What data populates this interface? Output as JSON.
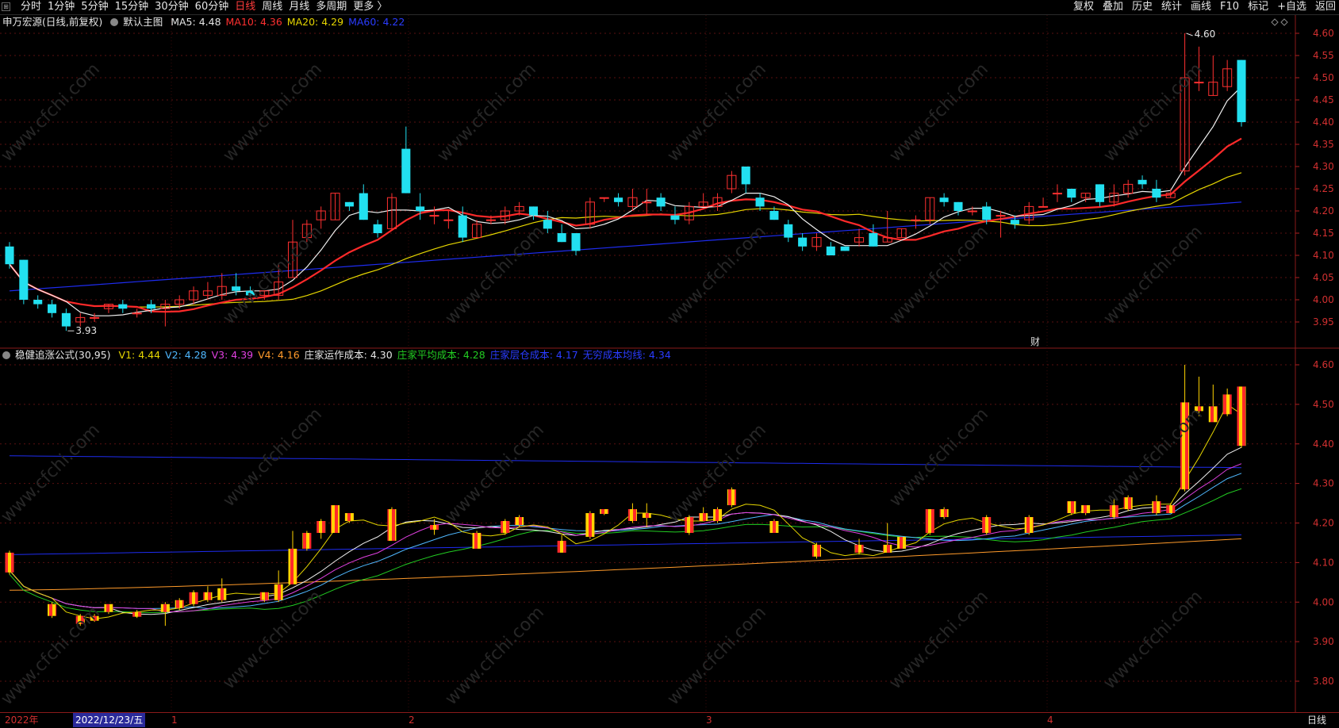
{
  "toolbar": {
    "left": [
      "分时",
      "1分钟",
      "5分钟",
      "15分钟",
      "30分钟",
      "60分钟",
      "日线",
      "周线",
      "月线",
      "多周期",
      "更多 〉"
    ],
    "active": "日线",
    "right": [
      "复权",
      "叠加",
      "历史",
      "统计",
      "画线",
      "F10",
      "标记",
      "+自选",
      "返回"
    ]
  },
  "main_header": {
    "stock": "申万宏源(日线,前复权)",
    "template": "默认主图",
    "ma": [
      {
        "label": "MA5: 4.48",
        "color": "#e6e6e6"
      },
      {
        "label": "MA10: 4.36",
        "color": "#ff3030"
      },
      {
        "label": "MA20: 4.29",
        "color": "#e6d600"
      },
      {
        "label": "MA60: 4.22",
        "color": "#2a3cff"
      }
    ]
  },
  "sub_header": {
    "name": "稳健追涨公式(30,95)",
    "items": [
      {
        "label": "V1: 4.44",
        "color": "#e6d600"
      },
      {
        "label": "V2: 4.28",
        "color": "#4fb8ff"
      },
      {
        "label": "V3: 4.39",
        "color": "#e040e0"
      },
      {
        "label": "V4: 4.16",
        "color": "#ff9a2a"
      },
      {
        "label": "庄家运作成本: 4.30",
        "color": "#e6e6e6"
      },
      {
        "label": "庄家平均成本: 4.28",
        "color": "#22cc22"
      },
      {
        "label": "庄家层仓成本: 4.17",
        "color": "#2a3cff"
      },
      {
        "label": "无穷成本均线: 4.34",
        "color": "#2a3cff"
      }
    ]
  },
  "axis_main": [
    "4.60",
    "4.55",
    "4.50",
    "4.45",
    "4.40",
    "4.35",
    "4.30",
    "4.25",
    "4.20",
    "4.15",
    "4.10",
    "4.05",
    "4.00",
    "3.95"
  ],
  "axis_sub": [
    "4.60",
    "4.50",
    "4.40",
    "4.30",
    "4.20",
    "4.10",
    "4.00",
    "3.90",
    "3.80"
  ],
  "annotations": {
    "high": "4.60",
    "low": "3.93",
    "cai": "财"
  },
  "status": {
    "year": "2022年",
    "date": "2022/12/23/五",
    "m1": "1",
    "m2": "2",
    "m3": "3",
    "m4": "4",
    "mode": "日线"
  },
  "watermark": "www.cfchi.com",
  "candles": [
    [
      4.12,
      4.08,
      4.13,
      4.07
    ],
    [
      4.09,
      4.0,
      4.09,
      3.99
    ],
    [
      4.0,
      3.99,
      4.01,
      3.98
    ],
    [
      3.99,
      3.97,
      4.0,
      3.96
    ],
    [
      3.97,
      3.94,
      3.98,
      3.93
    ],
    [
      3.95,
      3.96,
      3.97,
      3.94
    ],
    [
      3.96,
      3.96,
      3.97,
      3.95
    ],
    [
      3.98,
      3.99,
      3.99,
      3.97
    ],
    [
      3.99,
      3.98,
      4.0,
      3.97
    ],
    [
      3.97,
      3.97,
      3.98,
      3.96
    ],
    [
      3.99,
      3.98,
      4.0,
      3.97
    ],
    [
      3.98,
      3.99,
      4.0,
      3.94
    ],
    [
      3.99,
      4.0,
      4.01,
      3.98
    ],
    [
      4.0,
      4.02,
      4.03,
      3.99
    ],
    [
      4.01,
      4.02,
      4.04,
      4.0
    ],
    [
      4.01,
      4.03,
      4.06,
      4.0
    ],
    [
      4.03,
      4.02,
      4.06,
      4.01
    ],
    [
      4.02,
      4.01,
      4.03,
      4.01
    ],
    [
      4.01,
      4.02,
      4.02,
      4.0
    ],
    [
      4.01,
      4.04,
      4.08,
      4.0
    ],
    [
      4.05,
      4.13,
      4.18,
      4.05
    ],
    [
      4.14,
      4.17,
      4.18,
      4.13
    ],
    [
      4.18,
      4.2,
      4.21,
      4.16
    ],
    [
      4.18,
      4.24,
      4.24,
      4.18
    ],
    [
      4.22,
      4.21,
      4.22,
      4.2
    ],
    [
      4.24,
      4.18,
      4.26,
      4.18
    ],
    [
      4.17,
      4.15,
      4.18,
      4.14
    ],
    [
      4.16,
      4.23,
      4.24,
      4.16
    ],
    [
      4.34,
      4.24,
      4.39,
      4.24
    ],
    [
      4.21,
      4.2,
      4.24,
      4.18
    ],
    [
      4.19,
      4.19,
      4.21,
      4.17
    ],
    [
      4.18,
      4.18,
      4.2,
      4.16
    ],
    [
      4.19,
      4.14,
      4.21,
      4.13
    ],
    [
      4.14,
      4.17,
      4.18,
      4.14
    ],
    [
      4.18,
      4.18,
      4.19,
      4.17
    ],
    [
      4.18,
      4.2,
      4.21,
      4.17
    ],
    [
      4.2,
      4.21,
      4.22,
      4.19
    ],
    [
      4.21,
      4.19,
      4.21,
      4.18
    ],
    [
      4.18,
      4.16,
      4.2,
      4.15
    ],
    [
      4.15,
      4.13,
      4.17,
      4.13
    ],
    [
      4.15,
      4.11,
      4.15,
      4.1
    ],
    [
      4.17,
      4.22,
      4.23,
      4.16
    ],
    [
      4.23,
      4.23,
      4.23,
      4.22
    ],
    [
      4.23,
      4.22,
      4.24,
      4.21
    ],
    [
      4.21,
      4.23,
      4.25,
      4.2
    ],
    [
      4.22,
      4.22,
      4.25,
      4.19
    ],
    [
      4.23,
      4.21,
      4.24,
      4.2
    ],
    [
      4.19,
      4.18,
      4.21,
      4.17
    ],
    [
      4.18,
      4.21,
      4.22,
      4.17
    ],
    [
      4.21,
      4.22,
      4.24,
      4.21
    ],
    [
      4.21,
      4.23,
      4.24,
      4.2
    ],
    [
      4.25,
      4.28,
      4.29,
      4.24
    ],
    [
      4.3,
      4.26,
      4.3,
      4.24
    ],
    [
      4.23,
      4.21,
      4.24,
      4.2
    ],
    [
      4.2,
      4.18,
      4.21,
      4.18
    ],
    [
      4.17,
      4.14,
      4.18,
      4.13
    ],
    [
      4.14,
      4.12,
      4.15,
      4.11
    ],
    [
      4.12,
      4.14,
      4.15,
      4.11
    ],
    [
      4.12,
      4.1,
      4.13,
      4.1
    ],
    [
      4.12,
      4.11,
      4.12,
      4.11
    ],
    [
      4.13,
      4.14,
      4.16,
      4.12
    ],
    [
      4.15,
      4.12,
      4.17,
      4.12
    ],
    [
      4.13,
      4.14,
      4.2,
      4.13
    ],
    [
      4.14,
      4.16,
      4.16,
      4.14
    ],
    [
      4.18,
      4.18,
      4.19,
      4.16
    ],
    [
      4.18,
      4.23,
      4.23,
      4.17
    ],
    [
      4.23,
      4.22,
      4.24,
      4.21
    ],
    [
      4.22,
      4.2,
      4.22,
      4.19
    ],
    [
      4.2,
      4.2,
      4.21,
      4.19
    ],
    [
      4.21,
      4.18,
      4.22,
      4.17
    ],
    [
      4.19,
      4.19,
      4.2,
      4.14
    ],
    [
      4.18,
      4.17,
      4.19,
      4.16
    ],
    [
      4.18,
      4.21,
      4.22,
      4.17
    ],
    [
      4.21,
      4.21,
      4.23,
      4.21
    ],
    [
      4.24,
      4.24,
      4.26,
      4.22
    ],
    [
      4.25,
      4.23,
      4.25,
      4.22
    ],
    [
      4.23,
      4.24,
      4.24,
      4.22
    ],
    [
      4.26,
      4.22,
      4.26,
      4.21
    ],
    [
      4.22,
      4.24,
      4.26,
      4.21
    ],
    [
      4.24,
      4.26,
      4.27,
      4.23
    ],
    [
      4.27,
      4.26,
      4.28,
      4.25
    ],
    [
      4.25,
      4.23,
      4.27,
      4.22
    ],
    [
      4.23,
      4.24,
      4.25,
      4.23
    ],
    [
      4.29,
      4.5,
      4.6,
      4.28
    ],
    [
      4.49,
      4.49,
      4.57,
      4.47
    ],
    [
      4.46,
      4.49,
      4.55,
      4.46
    ],
    [
      4.48,
      4.52,
      4.54,
      4.47
    ],
    [
      4.54,
      4.4,
      4.54,
      4.39
    ]
  ]
}
